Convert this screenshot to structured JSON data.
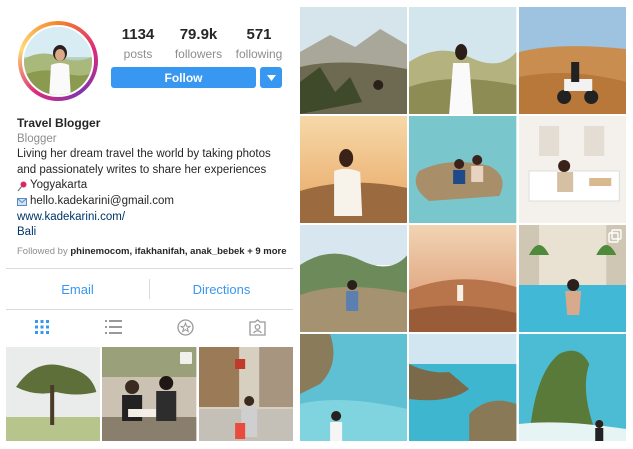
{
  "profile": {
    "stats": [
      {
        "num": "1134",
        "label": "posts"
      },
      {
        "num": "79.9k",
        "label": "followers"
      },
      {
        "num": "571",
        "label": "following"
      }
    ],
    "follow_label": "Follow",
    "name": "Travel Blogger",
    "category": "Blogger",
    "bio_line1": "Living her dream travel the world by taking photos",
    "bio_line2": "and passionately writes to share her experiences",
    "location": "Yogyakarta",
    "email": "hello.kadekarini@gmail.com",
    "website": "www.kadekarini.com/",
    "place": "Bali",
    "followed_prefix": "Followed by ",
    "followed_names": "phinemocom, ifakhanifah, anak_bebek",
    "followed_more": " + 9 more"
  },
  "contact": {
    "email_label": "Email",
    "directions_label": "Directions"
  },
  "tabs": [
    "grid-icon",
    "list-icon",
    "tagged-star-icon",
    "tagged-person-icon"
  ],
  "colors": {
    "accent": "#3897f0",
    "text": "#262626",
    "muted": "#8e8e8e",
    "link": "#003569"
  }
}
